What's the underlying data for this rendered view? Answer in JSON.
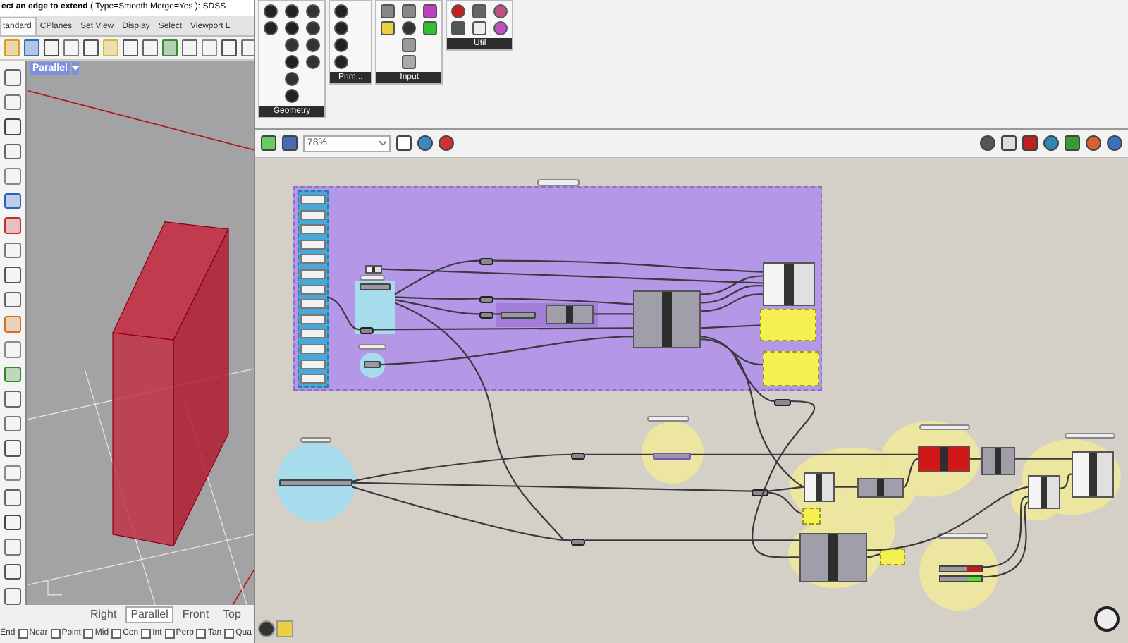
{
  "command_line": {
    "prompt": "**ect an edge to extend** ( Type=Smooth  Merge=Yes ): SDSS"
  },
  "menu_tabs": [
    {
      "label": "tandard",
      "selected": true
    },
    {
      "label": "CPlanes",
      "selected": false
    },
    {
      "label": "Set View",
      "selected": false
    },
    {
      "label": "Display",
      "selected": false
    },
    {
      "label": "Select",
      "selected": false
    },
    {
      "label": "Viewport L",
      "selected": false
    }
  ],
  "viewport": {
    "label": "Parallel"
  },
  "viewport_tabs": [
    {
      "label": "Right",
      "selected": false
    },
    {
      "label": "Parallel",
      "selected": true
    },
    {
      "label": "Front",
      "selected": false
    },
    {
      "label": "Top",
      "selected": false
    }
  ],
  "osnaps": [
    {
      "label": "End",
      "kind": "cut"
    },
    {
      "label": "Near",
      "kind": "checkbox",
      "checked": false
    },
    {
      "label": "Point",
      "kind": "checkbox",
      "checked": false
    },
    {
      "label": "Mid",
      "kind": "checkbox",
      "checked": false
    },
    {
      "label": "Cen",
      "kind": "checkbox",
      "checked": false
    },
    {
      "label": "Int",
      "kind": "checkbox",
      "checked": false
    },
    {
      "label": "Perp",
      "kind": "checkbox",
      "checked": false
    },
    {
      "label": "Tan",
      "kind": "checkbox",
      "checked": false
    },
    {
      "label": "Qua",
      "kind": "checkbox",
      "checked": false
    }
  ],
  "palette": [
    {
      "label": "Geometry"
    },
    {
      "label": "Prim..."
    },
    {
      "label": "Input"
    },
    {
      "label": "Util"
    }
  ],
  "canvas_toolbar": {
    "zoom": "78%"
  }
}
